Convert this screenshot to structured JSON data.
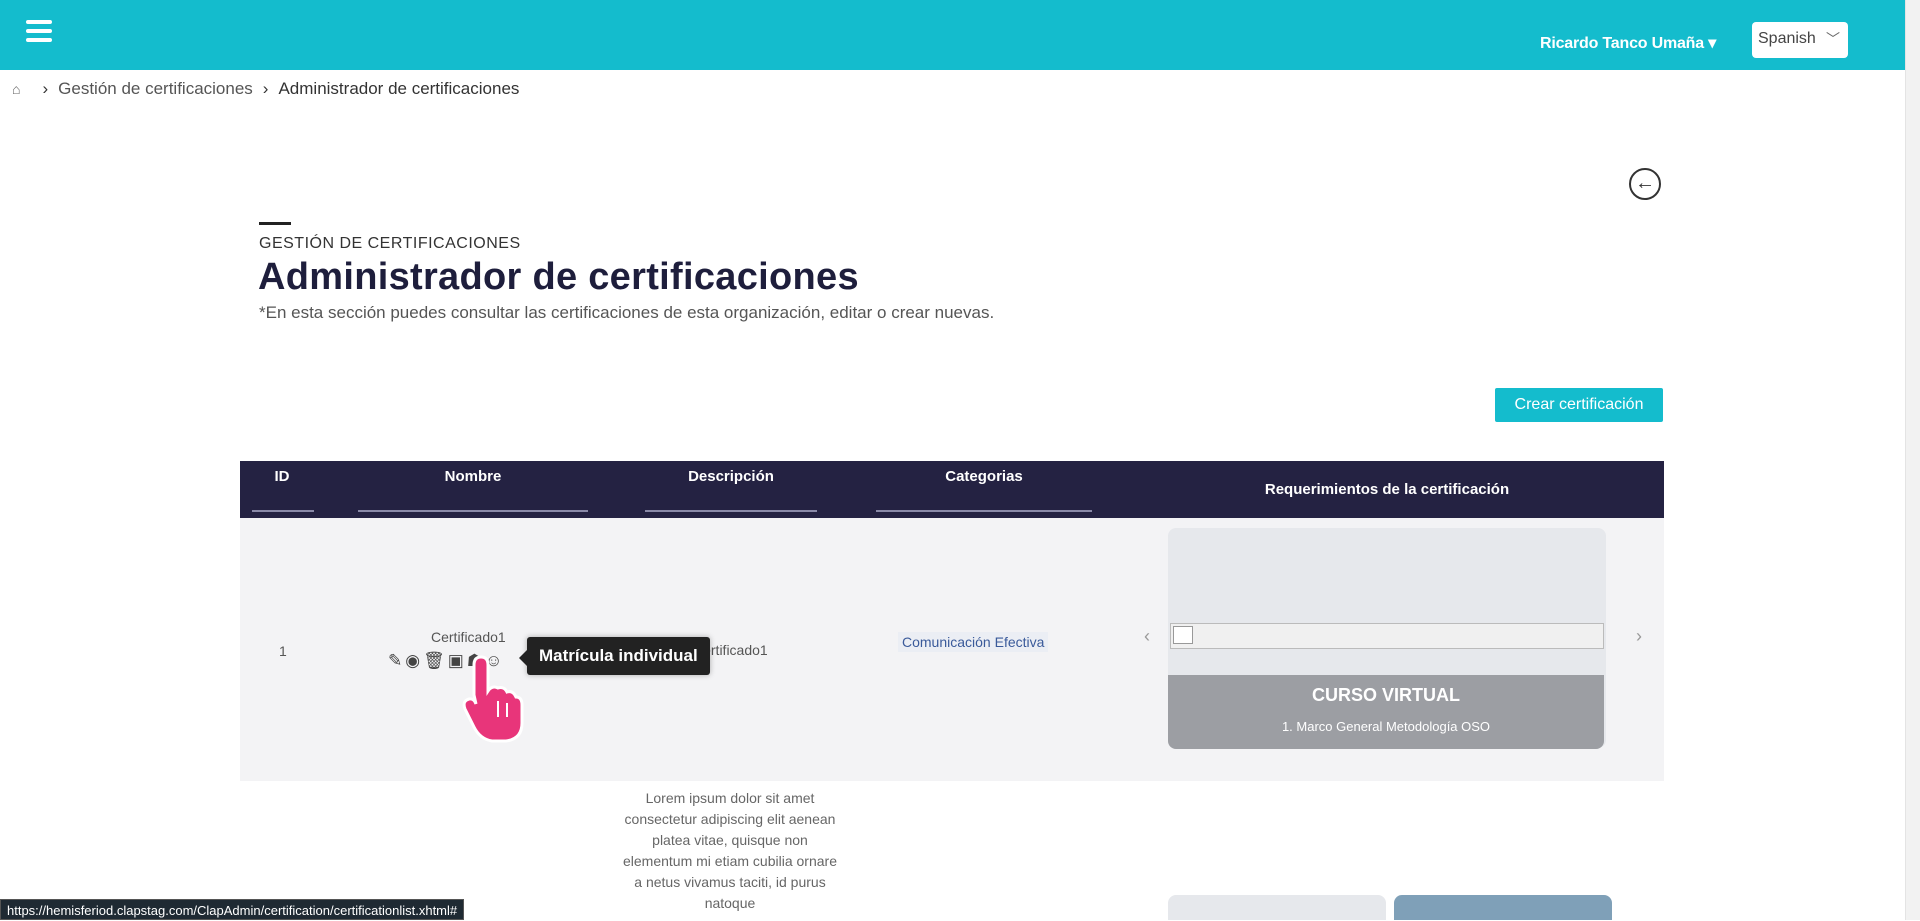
{
  "header": {
    "user_name": "Ricardo Tanco Umaña ▾",
    "language": "Spanish",
    "menu_icon": "hamburger-icon"
  },
  "breadcrumb": {
    "home_icon": "home-icon",
    "items": [
      "Gestión de certificaciones",
      "Administrador de certificaciones"
    ]
  },
  "page": {
    "section_label": "GESTIÓN DE CERTIFICACIONES",
    "title": "Administrador de certificaciones",
    "subtitle": "*En esta sección puedes consultar las certificaciones de esta organización, editar o crear nuevas.",
    "create_button": "Crear certificación"
  },
  "table": {
    "headers": [
      "ID",
      "Nombre",
      "Descripción",
      "Categorias",
      "Requerimientos de la certificación"
    ],
    "rows": [
      {
        "id": "1",
        "name": "Certificado1",
        "description": "Certificado1",
        "category": "Comunicación Efectiva",
        "requirement": {
          "title": "CURSO VIRTUAL",
          "subtitle": "1. Marco General Metodología OSO"
        }
      }
    ],
    "tooltip": "Matrícula individual",
    "action_icons": [
      "edit-icon",
      "view-icon",
      "delete-icon",
      "inbox-icon",
      "group-icon",
      "user-icon"
    ]
  },
  "lorem": "Lorem ipsum dolor sit amet consectetur adipiscing elit aenean platea vitae, quisque non elementum mi etiam cubilia ornare a netus vivamus taciti, id purus natoque",
  "status_url": "https://hemisferiod.clapstag.com/ClapAdmin/certification/certificationlist.xhtml#",
  "colors": {
    "accent": "#14bccd",
    "table_header": "#242242"
  }
}
